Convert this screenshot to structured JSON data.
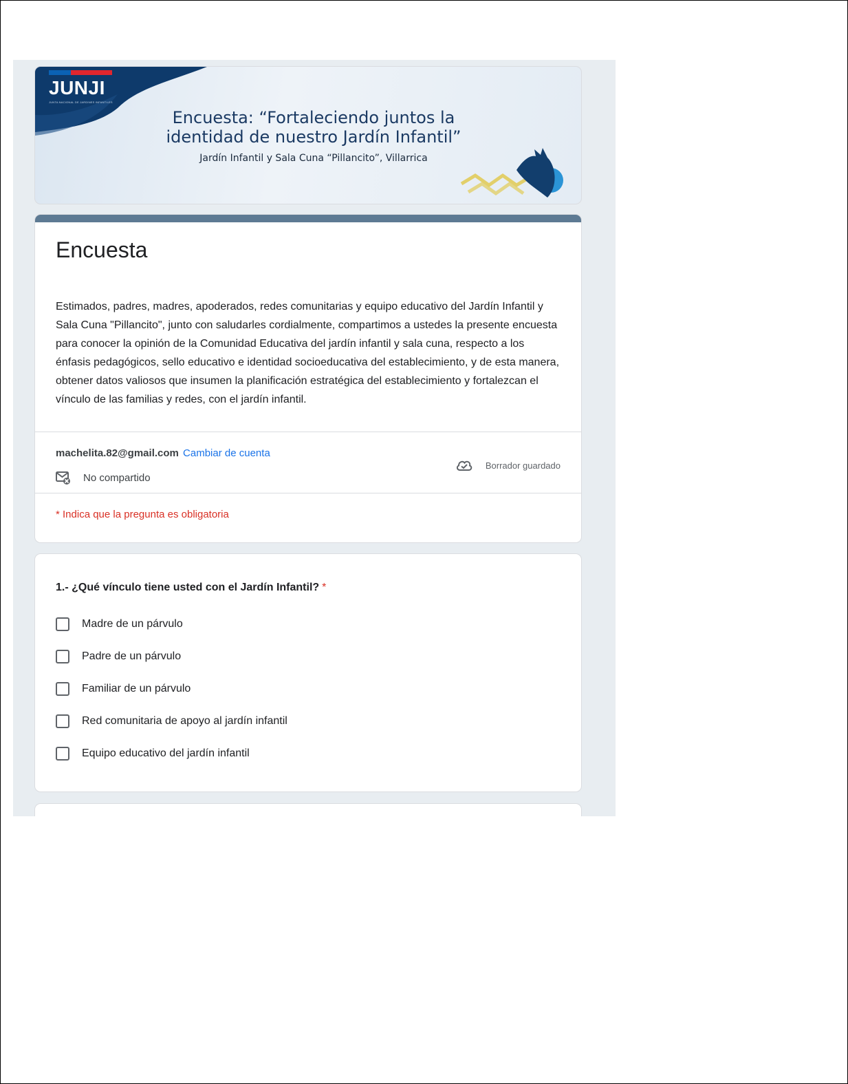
{
  "banner": {
    "logo_text": "JUNJI",
    "logo_subtext": "JUNTA NACIONAL DE JARDINES INFANTILES",
    "title_line1": "Encuesta: “Fortaleciendo juntos la",
    "title_line2": "identidad de nuestro Jardín Infantil”",
    "subtitle": "Jardín Infantil y Sala Cuna “Pillancito”, Villarrica"
  },
  "form": {
    "title": "Encuesta",
    "description": "Estimados, padres, madres, apoderados, redes comunitarias y equipo educativo del Jardín Infantil y Sala Cuna \"Pillancito\", junto con saludarles cordialmente, compartimos a ustedes la presente encuesta para conocer la opinión de la Comunidad Educativa del jardín infantil y sala cuna, respecto a los énfasis pedagógicos, sello educativo e identidad socioeducativa del establecimiento, y de esta manera,  obtener datos valiosos que insumen la planificación estratégica del establecimiento y fortalezcan el vínculo de las familias y redes, con el jardín infantil."
  },
  "account": {
    "email": "machelita.82@gmail.com",
    "switch_label": "Cambiar de cuenta",
    "not_shared_label": "No compartido",
    "not_shared_icon": "mail-not-shared-icon",
    "saved_label": "Borrador guardado",
    "saved_icon": "cloud-check-icon"
  },
  "required_note": "* Indica que la pregunta es obligatoria",
  "question1": {
    "title": "1.- ¿Qué vínculo tiene usted con el Jardín Infantil?",
    "required_mark": "*",
    "options": [
      {
        "label": "Madre de un párvulo",
        "checked": false
      },
      {
        "label": "Padre de un párvulo",
        "checked": false
      },
      {
        "label": "Familiar de un párvulo",
        "checked": false
      },
      {
        "label": "Red comunitaria de apoyo al jardín infantil",
        "checked": false
      },
      {
        "label": "Equipo educativo del jardín infantil",
        "checked": false
      }
    ]
  },
  "colors": {
    "header_bar": "#5d7a93",
    "link": "#1a73e8",
    "required": "#d93025",
    "background": "#e8edf1",
    "banner_navy": "#0e3a6b"
  }
}
